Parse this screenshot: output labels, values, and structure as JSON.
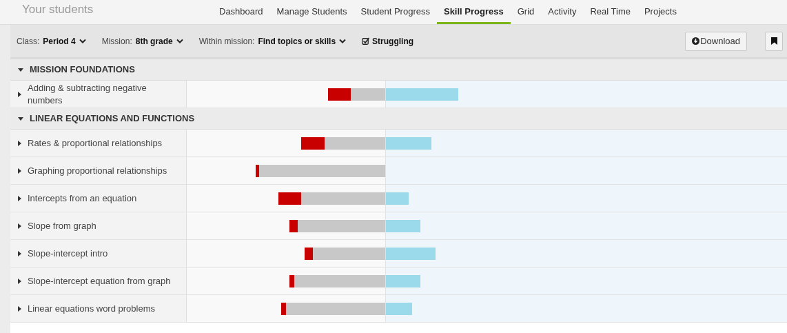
{
  "header": {
    "title": "Your students"
  },
  "tabs": [
    {
      "label": "Dashboard",
      "selected": false
    },
    {
      "label": "Manage Students",
      "selected": false
    },
    {
      "label": "Student Progress",
      "selected": false
    },
    {
      "label": "Skill Progress",
      "selected": true
    },
    {
      "label": "Grid",
      "selected": false
    },
    {
      "label": "Activity",
      "selected": false
    },
    {
      "label": "Real Time",
      "selected": false
    },
    {
      "label": "Projects",
      "selected": false
    }
  ],
  "filters": [
    {
      "label": "Class:",
      "value": "Period 4"
    },
    {
      "label": "Mission:",
      "value": "8th grade"
    },
    {
      "label": "Within mission:",
      "value": "Find topics or skills"
    }
  ],
  "struggling_filter": {
    "label": "Struggling",
    "checked": true
  },
  "download_button": {
    "label": "Download"
  },
  "sections": [
    {
      "title": "MISSION FOUNDATIONS",
      "expanded": true,
      "skills": [
        {
          "name": "Adding & subtracting negative numbers",
          "expanded": false
        }
      ]
    },
    {
      "title": "LINEAR EQUATIONS AND FUNCTIONS",
      "expanded": true,
      "skills": [
        {
          "name": "Rates & proportional relationships",
          "expanded": false
        },
        {
          "name": "Graphing proportional relationships",
          "expanded": false
        },
        {
          "name": "Intercepts from an equation",
          "expanded": false
        },
        {
          "name": "Slope from graph",
          "expanded": false
        },
        {
          "name": "Slope-intercept intro",
          "expanded": false
        },
        {
          "name": "Slope-intercept equation from graph",
          "expanded": false
        },
        {
          "name": "Linear equations word problems",
          "expanded": false
        }
      ]
    }
  ]
}
